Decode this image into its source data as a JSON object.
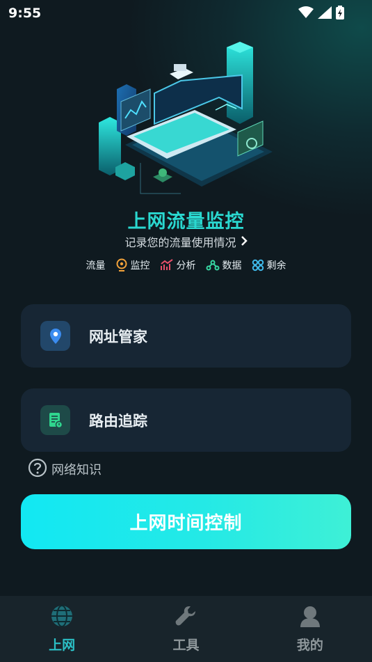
{
  "status_bar": {
    "time": "9:55"
  },
  "hero": {
    "title": "上网流量监控",
    "subtitle": "记录您的流量使用情况",
    "features": [
      {
        "label": "流量",
        "icon": "none"
      },
      {
        "label": "监控",
        "icon": "location-pin-icon",
        "color": "#f2a23a"
      },
      {
        "label": "分析",
        "icon": "trend-chart-icon",
        "color": "#e8506a"
      },
      {
        "label": "数据",
        "icon": "nodes-icon",
        "color": "#36d6a2"
      },
      {
        "label": "剩余",
        "icon": "grid-icon",
        "color": "#3fb8e8"
      }
    ]
  },
  "cards": {
    "address_manager": {
      "label": "网址管家",
      "icon": "location-pin-icon"
    },
    "route_trace": {
      "label": "路由追踪",
      "icon": "document-icon"
    }
  },
  "knowledge": {
    "label": "网络知识",
    "icon": "question-circle-icon"
  },
  "cta": {
    "label": "上网时间控制"
  },
  "bottom_nav": {
    "items": [
      {
        "label": "上网",
        "icon": "globe-icon",
        "active": true
      },
      {
        "label": "工具",
        "icon": "wrench-icon",
        "active": false
      },
      {
        "label": "我的",
        "icon": "person-icon",
        "active": false
      }
    ]
  },
  "colors": {
    "accent": "#2bc0c6",
    "title": "#2ad8d0",
    "card_bg": "#172634",
    "cta_gradient_start": "#12e8f3",
    "cta_gradient_end": "#3ef0d6"
  }
}
